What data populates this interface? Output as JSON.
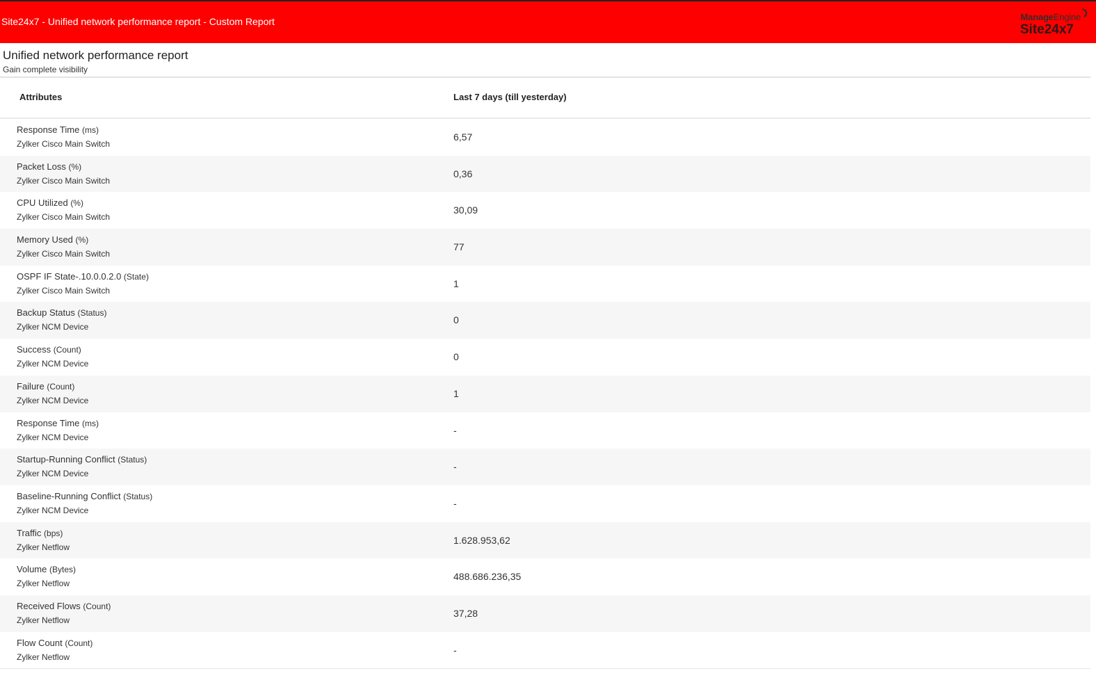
{
  "header": {
    "title": "Site24x7 - Unified network performance report - Custom Report",
    "bg_color": "#ff0000",
    "logo_brand_bold": "Manage",
    "logo_brand_light": "Engine",
    "logo_product": "Site24x7"
  },
  "report": {
    "title": "Unified network performance report",
    "subtitle": "Gain complete visibility"
  },
  "table": {
    "headers": {
      "attribute": "Attributes",
      "period": "Last 7 days (till yesterday)"
    },
    "rows": [
      {
        "name": "Response Time",
        "unit": "(ms)",
        "monitor": "Zylker Cisco Main Switch",
        "value": "6,57"
      },
      {
        "name": "Packet Loss",
        "unit": "(%)",
        "monitor": "Zylker Cisco Main Switch",
        "value": "0,36"
      },
      {
        "name": "CPU Utilized",
        "unit": "(%)",
        "monitor": "Zylker Cisco Main Switch",
        "value": "30,09"
      },
      {
        "name": "Memory Used",
        "unit": "(%)",
        "monitor": "Zylker Cisco Main Switch",
        "value": "77"
      },
      {
        "name": "OSPF IF State-.10.0.0.2.0",
        "unit": "(State)",
        "monitor": "Zylker Cisco Main Switch",
        "value": "1"
      },
      {
        "name": "Backup Status",
        "unit": "(Status)",
        "monitor": "Zylker NCM Device",
        "value": "0"
      },
      {
        "name": "Success",
        "unit": "(Count)",
        "monitor": "Zylker NCM Device",
        "value": "0"
      },
      {
        "name": "Failure",
        "unit": "(Count)",
        "monitor": "Zylker NCM Device",
        "value": "1"
      },
      {
        "name": "Response Time",
        "unit": "(ms)",
        "monitor": "Zylker NCM Device",
        "value": "-"
      },
      {
        "name": "Startup-Running Conflict",
        "unit": "(Status)",
        "monitor": "Zylker NCM Device",
        "value": "-"
      },
      {
        "name": "Baseline-Running Conflict",
        "unit": "(Status)",
        "monitor": "Zylker NCM Device",
        "value": "-"
      },
      {
        "name": "Traffic",
        "unit": "(bps)",
        "monitor": "Zylker Netflow",
        "value": "1.628.953,62"
      },
      {
        "name": "Volume",
        "unit": "(Bytes)",
        "monitor": "Zylker Netflow",
        "value": "488.686.236,35"
      },
      {
        "name": "Received Flows",
        "unit": "(Count)",
        "monitor": "Zylker Netflow",
        "value": "37,28"
      },
      {
        "name": "Flow Count",
        "unit": "(Count)",
        "monitor": "Zylker Netflow",
        "value": "-"
      }
    ]
  }
}
